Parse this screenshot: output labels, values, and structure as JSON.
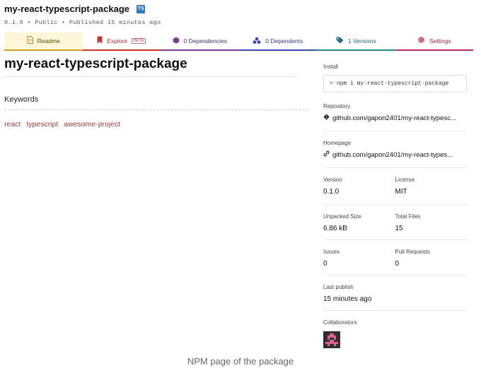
{
  "package": {
    "name": "my-react-typescript-package",
    "ts_badge": "TS",
    "meta": "0.1.0 • Public • Published 15 minutes ago"
  },
  "tabs": [
    {
      "label": "Readme",
      "icon": "document-icon"
    },
    {
      "label": "Explore",
      "icon": "bookmark-icon",
      "badge": "BETA"
    },
    {
      "label": "0 Dependencies",
      "icon": "cube-icon"
    },
    {
      "label": "0 Dependents",
      "icon": "cubes-icon"
    },
    {
      "label": "1 Versions",
      "icon": "tag-icon"
    },
    {
      "label": "Settings",
      "icon": "gear-icon"
    }
  ],
  "readme": {
    "title": "my-react-typescript-package",
    "keywords_heading": "Keywords",
    "keywords": [
      "react",
      "typescript",
      "awesome-project"
    ]
  },
  "sidebar": {
    "install_label": "Install",
    "install_prompt": ">",
    "install_command": "npm i my-react-typescript-package",
    "repository_label": "Repository",
    "repository_value": "github.com/gapon2401/my-react-typesc...",
    "homepage_label": "Homepage",
    "homepage_value": "github.com/gapon2401/my-react-types...",
    "version_label": "Version",
    "version_value": "0.1.0",
    "license_label": "License",
    "license_value": "MIT",
    "unpacked_label": "Unpacked Size",
    "unpacked_value": "6.86 kB",
    "files_label": "Total Files",
    "files_value": "15",
    "issues_label": "Issues",
    "issues_value": "0",
    "prs_label": "Pull Requests",
    "prs_value": "0",
    "publish_label": "Last publish",
    "publish_value": "15 minutes ago",
    "collaborators_label": "Collaborators"
  },
  "caption": "NPM page of the package",
  "colors": {
    "readme_tab": "#c9a227",
    "explore_tab": "#c0392b",
    "deps_tab": "#7b3a8f",
    "dependents_tab": "#3a4ab0",
    "versions_tab": "#1f8a8a",
    "settings_tab": "#b0305a",
    "keyword_link": "#9a3b3b"
  }
}
